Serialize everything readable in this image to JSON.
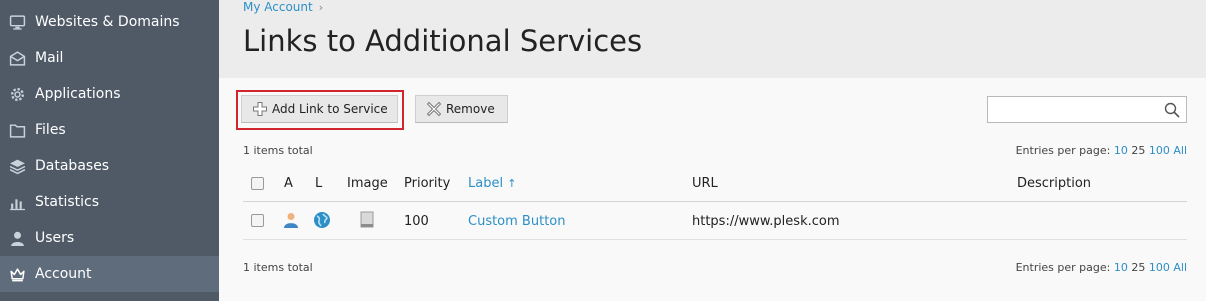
{
  "sidebar": {
    "items": [
      {
        "label": "Websites & Domains",
        "icon": "monitor-icon"
      },
      {
        "label": "Mail",
        "icon": "envelope-icon"
      },
      {
        "label": "Applications",
        "icon": "gear-icon"
      },
      {
        "label": "Files",
        "icon": "folder-icon"
      },
      {
        "label": "Databases",
        "icon": "database-icon"
      },
      {
        "label": "Statistics",
        "icon": "bar-chart-icon"
      },
      {
        "label": "Users",
        "icon": "user-icon"
      },
      {
        "label": "Account",
        "icon": "crown-icon",
        "active": true
      }
    ]
  },
  "header": {
    "breadcrumb": "My Account",
    "title": "Links to Additional Services"
  },
  "toolbar": {
    "add_label": "Add Link to Service",
    "remove_label": "Remove",
    "search_placeholder": ""
  },
  "list": {
    "total_top": "1 items total",
    "total_bottom": "1 items total",
    "entries_label": "Entries per page:",
    "page_sizes": [
      "10",
      "25",
      "100",
      "All"
    ],
    "columns": {
      "a": "A",
      "l": "L",
      "image": "Image",
      "priority": "Priority",
      "label": "Label",
      "sort_indicator": "↑",
      "url": "URL",
      "description": "Description"
    },
    "rows": [
      {
        "a_icon": "user-icon",
        "l_icon": "globe-icon",
        "image_icon": "document-icon",
        "priority": "100",
        "label": "Custom Button",
        "url": "https://www.plesk.com",
        "description": ""
      }
    ]
  },
  "colors": {
    "sidebar_bg": "#4f5a66",
    "sidebar_active": "#5e6c7c",
    "link": "#2d8fc7",
    "highlight": "#d0262d"
  }
}
